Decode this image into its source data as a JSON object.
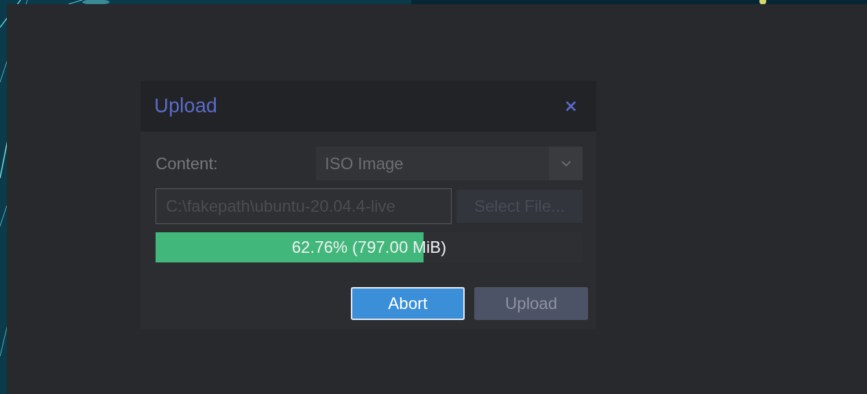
{
  "dialog": {
    "title": "Upload",
    "content": {
      "label": "Content:",
      "value": "ISO Image",
      "disabled": true
    },
    "file": {
      "value": "C:\\fakepath\\ubuntu-20.04.4-live",
      "disabled": true
    },
    "select_file": {
      "label": "Select File...",
      "disabled": true
    },
    "progress": {
      "level": 0.6276,
      "reading": "62.76% (797.00 MiB)"
    },
    "buttons": [
      {
        "label": "Abort",
        "disabled": false
      },
      {
        "label": "Upload",
        "disabled": true
      }
    ]
  }
}
